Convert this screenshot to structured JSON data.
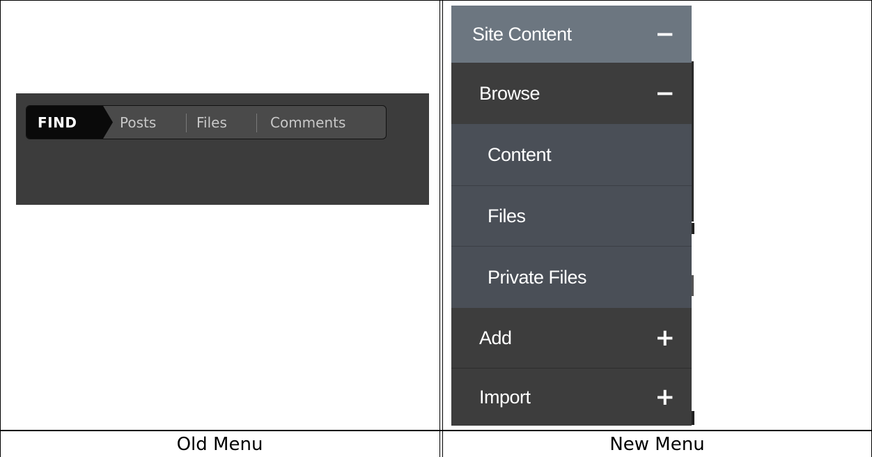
{
  "old_menu": {
    "find_label": "FIND",
    "links": [
      "Posts",
      "Files",
      "Comments"
    ]
  },
  "new_menu": {
    "header": {
      "label": "Site Content",
      "toggle": "−"
    },
    "browse": {
      "label": "Browse",
      "toggle": "−"
    },
    "browse_items": [
      "Content",
      "Files",
      "Private Files"
    ],
    "add": {
      "label": "Add",
      "toggle": "+"
    },
    "import": {
      "label": "Import",
      "toggle": "+"
    }
  },
  "captions": {
    "left": "Old Menu",
    "right": "New Menu"
  },
  "colors": {
    "header_bg": "#6c7680",
    "browse_bg": "#3d3d3d",
    "subitem_bg": "#4a4f57",
    "old_menu_bg": "#3c3c3c"
  }
}
